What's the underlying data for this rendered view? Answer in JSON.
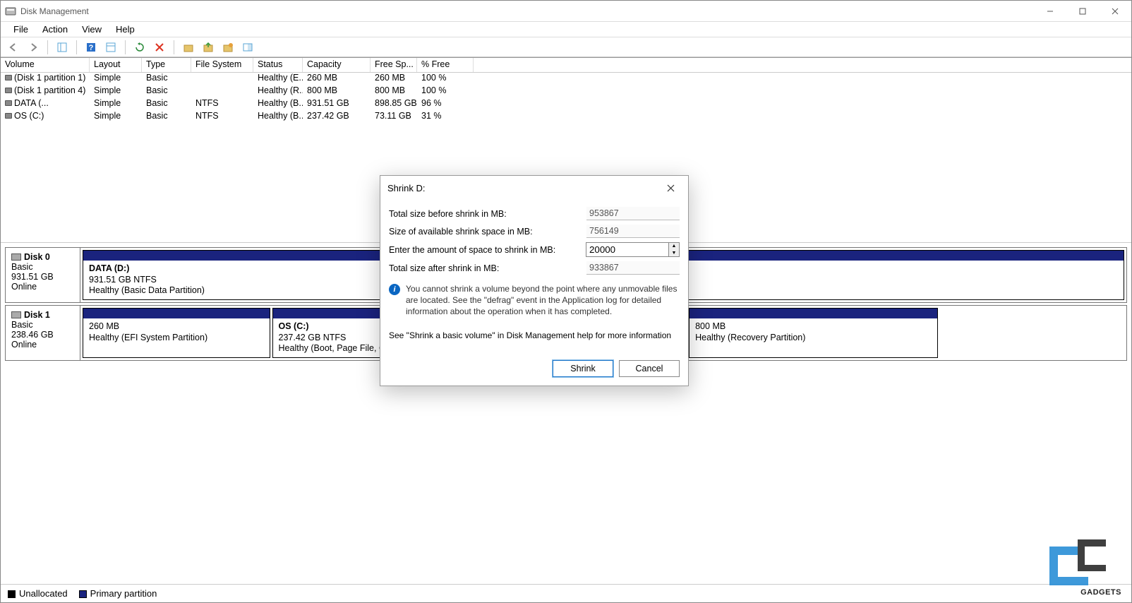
{
  "window": {
    "title": "Disk Management"
  },
  "menu": {
    "file": "File",
    "action": "Action",
    "view": "View",
    "help": "Help"
  },
  "table": {
    "headers": {
      "volume": "Volume",
      "layout": "Layout",
      "type": "Type",
      "filesystem": "File System",
      "status": "Status",
      "capacity": "Capacity",
      "free": "Free Sp...",
      "pct": "% Free"
    },
    "rows": [
      {
        "volume": "(Disk 1 partition 1)",
        "layout": "Simple",
        "type": "Basic",
        "fs": "",
        "status": "Healthy (E...",
        "capacity": "260 MB",
        "free": "260 MB",
        "pct": "100 %"
      },
      {
        "volume": "(Disk 1 partition 4)",
        "layout": "Simple",
        "type": "Basic",
        "fs": "",
        "status": "Healthy (R...",
        "capacity": "800 MB",
        "free": "800 MB",
        "pct": "100 %"
      },
      {
        "volume": "DATA (...",
        "layout": "Simple",
        "type": "Basic",
        "fs": "NTFS",
        "status": "Healthy (B...",
        "capacity": "931.51 GB",
        "free": "898.85 GB",
        "pct": "96 %"
      },
      {
        "volume": "OS (C:)",
        "layout": "Simple",
        "type": "Basic",
        "fs": "NTFS",
        "status": "Healthy (B...",
        "capacity": "237.42 GB",
        "free": "73.11 GB",
        "pct": "31 %"
      }
    ]
  },
  "disks": [
    {
      "name": "Disk 0",
      "type": "Basic",
      "size": "931.51 GB",
      "status": "Online",
      "partitions": [
        {
          "name": "DATA  (D:)",
          "info": "931.51 GB NTFS",
          "health": "Healthy (Basic Data Partition)",
          "grow": 1
        }
      ]
    },
    {
      "name": "Disk 1",
      "type": "Basic",
      "size": "238.46 GB",
      "status": "Online",
      "partitions": [
        {
          "name": "",
          "info": "260 MB",
          "health": "Healthy (EFI System Partition)",
          "grow": 0.18
        },
        {
          "name": "OS  (C:)",
          "info": "237.42 GB NTFS",
          "health": "Healthy (Boot, Page File, Crash Dump, Basic Data Partition)",
          "grow": 0.4
        },
        {
          "name": "",
          "info": "800 MB",
          "health": "Healthy (Recovery Partition)",
          "grow": 0.24
        }
      ]
    }
  ],
  "legend": {
    "unallocated": "Unallocated",
    "primary": "Primary partition"
  },
  "dialog": {
    "title": "Shrink D:",
    "labels": {
      "total_before": "Total size before shrink in MB:",
      "avail": "Size of available shrink space in MB:",
      "enter": "Enter the amount of space to shrink in MB:",
      "total_after": "Total size after shrink in MB:"
    },
    "values": {
      "total_before": "953867",
      "avail": "756149",
      "enter": "20000",
      "total_after": "933867"
    },
    "info": "You cannot shrink a volume beyond the point where any unmovable files are located. See the \"defrag\" event in the Application log for detailed information about the operation when it has completed.",
    "help": "See \"Shrink a basic volume\" in Disk Management help for more information",
    "btn_shrink": "Shrink",
    "btn_cancel": "Cancel"
  },
  "watermark": "GADGETS"
}
